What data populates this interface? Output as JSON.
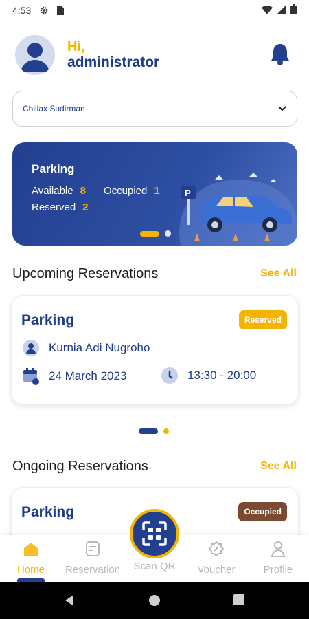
{
  "status_bar": {
    "time": "4:53"
  },
  "header": {
    "greeting": "Hi,",
    "username": "administrator"
  },
  "location": {
    "selected": "Chillax Sudirman"
  },
  "banner": {
    "title": "Parking",
    "available_label": "Available",
    "available_value": "8",
    "occupied_label": "Occupied",
    "occupied_value": "1",
    "reserved_label": "Reserved",
    "reserved_value": "2"
  },
  "upcoming": {
    "title": "Upcoming Reservations",
    "see_all": "See All",
    "card": {
      "title": "Parking",
      "status": "Reserved",
      "name": "Kurnia Adi Nugroho",
      "date": "24 March 2023",
      "time": "13:30 - 20:00"
    }
  },
  "ongoing": {
    "title": "Ongoing Reservations",
    "see_all": "See All",
    "card": {
      "title": "Parking",
      "status": "Occupied"
    }
  },
  "bottom_nav": {
    "items": [
      {
        "label": "Home",
        "icon": "home-icon",
        "active": true
      },
      {
        "label": "Reservation",
        "icon": "reservation-icon"
      },
      {
        "label": "Scan QR",
        "icon": "scan-qr-icon"
      },
      {
        "label": "Voucher",
        "icon": "voucher-icon"
      },
      {
        "label": "Profile",
        "icon": "profile-icon"
      }
    ]
  },
  "colors": {
    "primary": "#233f8f",
    "accent": "#f5b400",
    "occupied": "#7a4a33"
  }
}
